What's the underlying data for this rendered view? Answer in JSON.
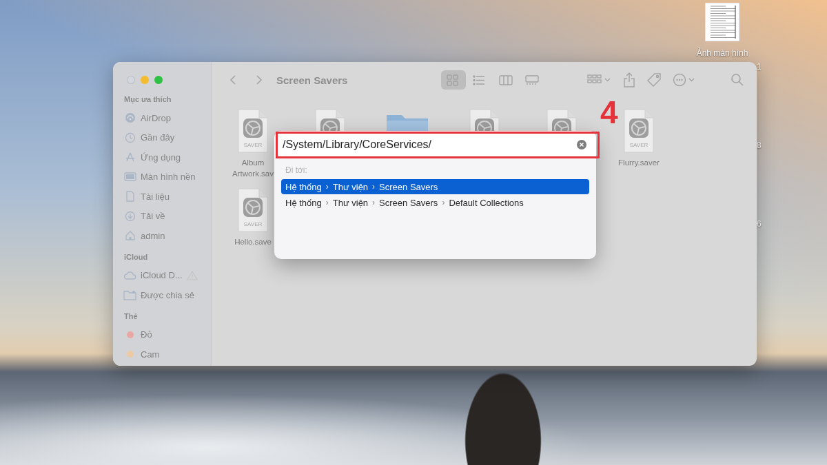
{
  "desktop": {
    "icons": [
      {
        "label": "Ảnh màn hình"
      }
    ],
    "partial_labels": [
      "1",
      "8",
      "6"
    ]
  },
  "window": {
    "title": "Screen Savers",
    "traffic_lights": [
      {
        "kind": "close",
        "color": "#d3d8de"
      },
      {
        "kind": "minimize",
        "color": "#f4bd30"
      },
      {
        "kind": "zoom",
        "color": "#2ec244"
      }
    ],
    "sidebar": [
      {
        "heading": "Mục ưa thích",
        "items": [
          {
            "label": "AirDrop",
            "kind": "airdrop"
          },
          {
            "label": "Gần đây",
            "kind": "clock"
          },
          {
            "label": "Ứng dụng",
            "kind": "apps"
          },
          {
            "label": "Màn hình nền",
            "kind": "desktop"
          },
          {
            "label": "Tài liệu",
            "kind": "document"
          },
          {
            "label": "Tải về",
            "kind": "download"
          },
          {
            "label": "admin",
            "kind": "home"
          }
        ]
      },
      {
        "heading": "iCloud",
        "items": [
          {
            "label": "iCloud D...",
            "kind": "cloud",
            "warning": true
          },
          {
            "label": "Được chia sẻ",
            "kind": "shared"
          }
        ]
      },
      {
        "heading": "Thẻ",
        "items": [
          {
            "label": "Đỏ",
            "kind": "tag",
            "color": "#eba7a3"
          },
          {
            "label": "Cam",
            "kind": "tag",
            "color": "#eccaa6"
          }
        ]
      }
    ],
    "view_modes": [
      {
        "kind": "icons",
        "selected": true
      },
      {
        "kind": "list",
        "selected": false
      },
      {
        "kind": "columns",
        "selected": false
      },
      {
        "kind": "gallery",
        "selected": false
      }
    ],
    "files": [
      {
        "kind": "saver",
        "name": "Album\nArtwork.sav",
        "badge": "SAVER"
      },
      {
        "kind": "saver"
      },
      {
        "kind": "folder"
      },
      {
        "kind": "saver"
      },
      {
        "kind": "saver"
      },
      {
        "kind": "saver",
        "name": "Flurry.saver",
        "badge": "SAVER"
      },
      {
        "kind": "saver",
        "name": "Hello.save",
        "badge": "SAVER"
      }
    ]
  },
  "go_to_folder": {
    "path": "/System/Library/CoreServices/",
    "heading": "Đi tới:",
    "suggestions": [
      {
        "segments": [
          "Hệ thống",
          "Thư viện",
          "Screen Savers"
        ],
        "separator": "›",
        "selected": true
      },
      {
        "segments": [
          "Hệ thống",
          "Thư viện",
          "Screen Savers",
          "Default Collections"
        ],
        "separator": "›",
        "selected": false
      }
    ]
  },
  "annotation": {
    "label": "4"
  }
}
